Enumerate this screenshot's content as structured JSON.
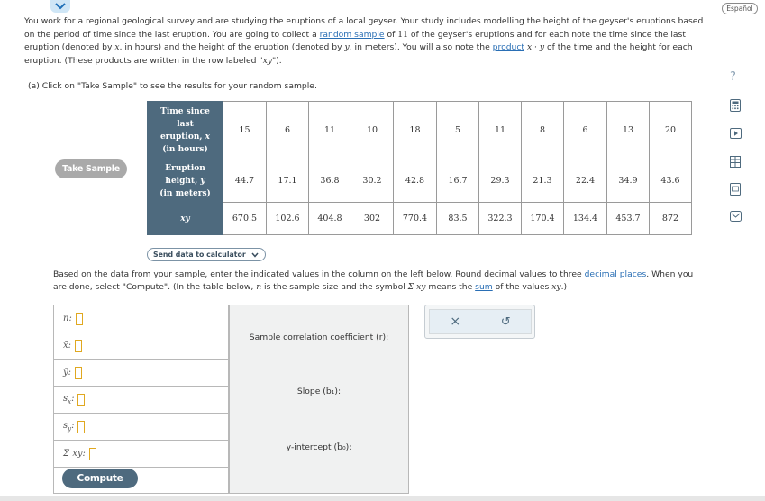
{
  "header": {
    "language_label": "Español"
  },
  "intro": {
    "p1": "You work for a regional geological survey and are studying the eruptions of a local geyser. Your study includes modelling the height of the geyser's eruptions based on the period of time since the last eruption. You are going to collect a ",
    "random_sample": "random sample",
    "p2": " of ",
    "n_value": "11",
    "p3": " of the geyser's eruptions and for each note the time since the last eruption (denoted by ",
    "x": "x",
    "p4": ", in hours) and the height of the eruption (denoted by ",
    "y": "y",
    "p5": ", in meters). You will also note the ",
    "product": "product",
    "xy_product": "x · y",
    "p6": " of the time and the height for each eruption. (These products are written in the row labeled \"",
    "xy_label": "xy",
    "p7": "\")."
  },
  "part_a": "(a) Click on \"Take Sample\" to see the results for your random sample.",
  "take_sample_label": "Take Sample",
  "table": {
    "row_headers": {
      "time_1": "Time since",
      "time_2": "last",
      "time_3": "eruption, ",
      "time_var": "x",
      "time_4": "(in hours)",
      "height_1": "Eruption",
      "height_2": "height, ",
      "height_var": "y",
      "height_3": "(in meters)",
      "xy": "xy"
    },
    "time": [
      "15",
      "6",
      "11",
      "10",
      "18",
      "5",
      "11",
      "8",
      "6",
      "13",
      "20"
    ],
    "height": [
      "44.7",
      "17.1",
      "36.8",
      "30.2",
      "42.8",
      "16.7",
      "29.3",
      "21.3",
      "22.4",
      "34.9",
      "43.6"
    ],
    "xy": [
      "670.5",
      "102.6",
      "404.8",
      "302",
      "770.4",
      "83.5",
      "322.3",
      "170.4",
      "134.4",
      "453.7",
      "872"
    ]
  },
  "send_to_calculator_label": "Send data to calculator",
  "instructions": {
    "t1": "Based on the data from your sample, enter the indicated values in the column on the left below. Round decimal values to three ",
    "decimal_places": "decimal places",
    "t2": ". When you are done, select \"Compute\". (In the table below, ",
    "n": "n",
    "t3": " is the sample size and the symbol ",
    "sigma_xy": "Σ xy",
    "t4": " means the ",
    "sum": "sum",
    "t5": " of the values ",
    "xy": "xy",
    "t6": ".)"
  },
  "inputs": {
    "n_label": "n:",
    "xbar_label": "x̄:",
    "ybar_label": "ȳ:",
    "sx_label": "s",
    "sx_sub": "x",
    "sy_label": "s",
    "sy_sub": "y",
    "sum_xy_label": "Σ xy:",
    "values": {
      "n": "",
      "xbar": "",
      "ybar": "",
      "sx": "",
      "sy": "",
      "sum_xy": ""
    }
  },
  "compute_label": "Compute",
  "results": {
    "r_label": "Sample correlation coefficient (r):",
    "slope_label": "Slope (b̂₁):",
    "intercept_label": "y-intercept (b̂₀):"
  },
  "actions": {
    "clear_icon": "×",
    "undo_icon": "↺"
  },
  "sidebar": {
    "help_icon": "?"
  },
  "colors": {
    "table_header": "#4e6a7e",
    "compute_button": "#4e6a7e",
    "take_sample_button": "#a9a9a9",
    "link": "#2a6fb5",
    "answer_box_border": "#e0a820"
  }
}
